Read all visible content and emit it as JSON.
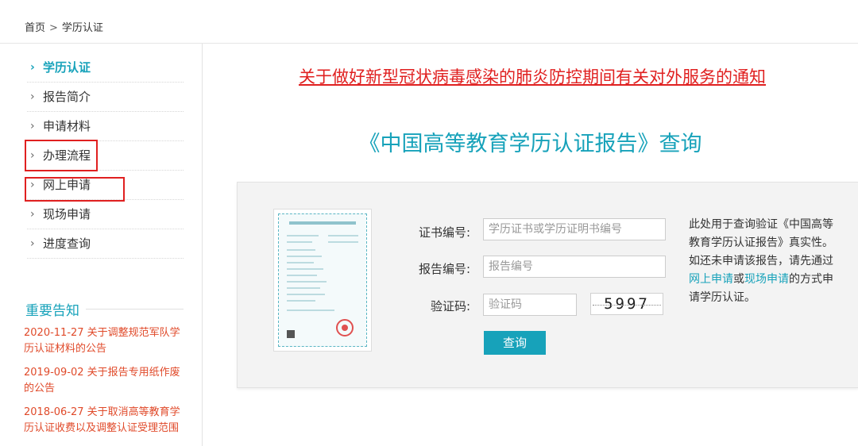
{
  "breadcrumb": {
    "home": "首页",
    "separator": ">",
    "current": "学历认证"
  },
  "sidebar": {
    "items": [
      {
        "label": "学历认证",
        "active": true
      },
      {
        "label": "报告简介"
      },
      {
        "label": "申请材料"
      },
      {
        "label": "办理流程",
        "highlighted": true
      },
      {
        "label": "网上申请",
        "highlighted": true
      },
      {
        "label": "现场申请"
      },
      {
        "label": "进度查询"
      }
    ],
    "chevron": "›"
  },
  "notices": {
    "title": "重要告知",
    "items": [
      "2020-11-27 关于调整规范军队学历认证材料的公告",
      "2019-09-02 关于报告专用纸作废的公告",
      "2018-06-27 关于取消高等教育学历认证收费以及调整认证受理范围"
    ]
  },
  "main": {
    "alert_link": "关于做好新型冠状病毒感染的肺炎防控期间有关对外服务的通知",
    "title": "《中国高等教育学历认证报告》查询"
  },
  "form": {
    "cert_label": "证书编号:",
    "cert_placeholder": "学历证书或学历证明书编号",
    "report_label": "报告编号:",
    "report_placeholder": "报告编号",
    "captcha_label": "验证码:",
    "captcha_placeholder": "验证码",
    "captcha_text": "5997",
    "submit": "查询"
  },
  "description": {
    "before": "此处用于查询验证《中国高等教育学历认证报告》真实性。如还未申请该报告，请先通过",
    "link_online": "网上申请",
    "middle": "或",
    "link_onsite": "现场申请",
    "after": "的方式申请学历认证。"
  },
  "colors": {
    "accent": "#17a2ba",
    "alert": "#e02020",
    "notice": "#e04a2a",
    "highlight_box": "#e02020"
  }
}
